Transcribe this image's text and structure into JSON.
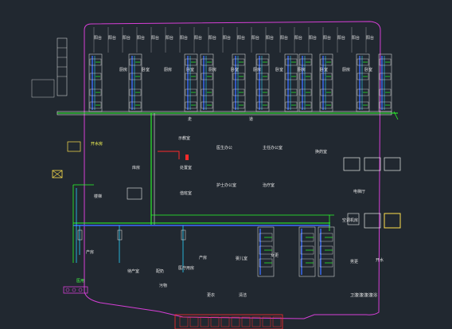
{
  "colors": {
    "background": "#212830",
    "outline": "#d63fd6",
    "supply_pipe": "#2aff2a",
    "return_pipe": "#3a6cff",
    "hot_pipe": "#ff2a2a",
    "wall": "#e8e8e8",
    "equipment": "#ffe14d",
    "riser": "#2ad3ff"
  },
  "plan": {
    "top_room_labels": [
      "阳台",
      "阳台",
      "阳台",
      "阳台",
      "阳台",
      "阳台",
      "阳台",
      "阳台",
      "阳台",
      "阳台",
      "阳台",
      "阳台",
      "阳台",
      "阳台",
      "阳台",
      "阳台",
      "阳台",
      "阳台",
      "阳台",
      "阳台"
    ],
    "top_room_names": [
      "厨房",
      "卧室",
      "厨房",
      "卧室",
      "厨房",
      "卧室",
      "厨房",
      "卧室",
      "厨房",
      "卧室",
      "厨房",
      "卧室"
    ],
    "corridor_labels": [
      "走",
      "道"
    ],
    "central_labels": [
      "医生办公",
      "主任办公室",
      "护士办公室",
      "治疗室",
      "示教室",
      "处置室",
      "值班室",
      "换药室",
      "库房"
    ],
    "lower_labels": [
      "产房",
      "待产室",
      "配奶",
      "产房",
      "医疗用房",
      "婴儿室",
      "女更",
      "男更",
      "开水",
      "污物",
      "更衣",
      "清洁"
    ],
    "left_labels": [
      "楼梯",
      "开水房",
      "医用"
    ],
    "right_labels": [
      "电梯厅",
      "空调机房"
    ],
    "bottom_labels": [
      "卫浴",
      "卫浴",
      "卫浴",
      "卫浴",
      "卫浴"
    ]
  }
}
